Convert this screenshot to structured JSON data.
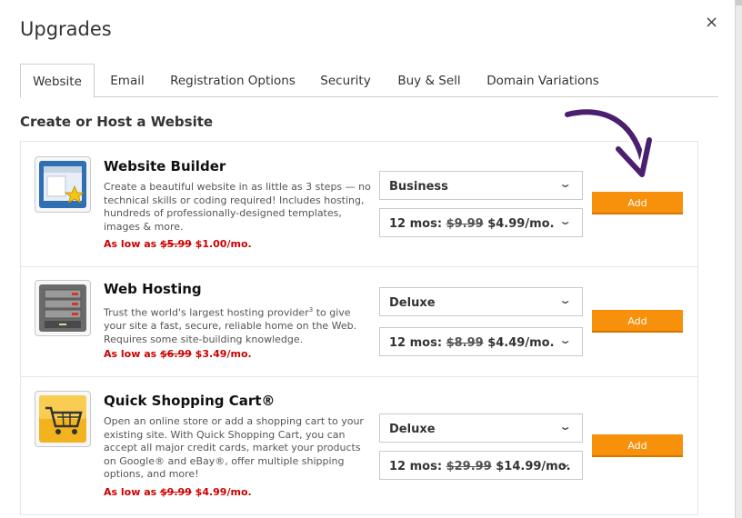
{
  "dialog": {
    "title": "Upgrades",
    "close_symbol": "×"
  },
  "tabs": [
    {
      "label": "Website",
      "active": true
    },
    {
      "label": "Email",
      "active": false
    },
    {
      "label": "Registration Options",
      "active": false
    },
    {
      "label": "Security",
      "active": false
    },
    {
      "label": "Buy & Sell",
      "active": false
    },
    {
      "label": "Domain Variations",
      "active": false
    }
  ],
  "section_title": "Create or Host a Website",
  "products": [
    {
      "name": "Website Builder",
      "icon": "website-builder-icon",
      "description": "Create a beautiful website in as little as 3 steps — no technical skills or coding required! Includes hosting, hundreds of professionally-designed templates, images & more.",
      "price_prefix": "As low as",
      "price_old": "$5.99",
      "price_new": "$1.00/mo.",
      "plan_select": "Business",
      "term_prefix": "12 mos:",
      "term_old": "$9.99",
      "term_new": "$4.99/mo.",
      "add_label": "Add"
    },
    {
      "name": "Web Hosting",
      "icon": "server-icon",
      "description_a": "Trust the world's largest hosting provider",
      "description_sup": "3",
      "description_b": " to give your site a fast, secure, reliable home on the Web. Requires some site-building knowledge.",
      "price_prefix": "As low as",
      "price_old": "$6.99",
      "price_new": "$3.49/mo.",
      "plan_select": "Deluxe",
      "term_prefix": "12 mos:",
      "term_old": "$8.99",
      "term_new": "$4.49/mo.",
      "add_label": "Add"
    },
    {
      "name": "Quick Shopping Cart®",
      "icon": "shopping-cart-icon",
      "description": "Open an online store or add a shopping cart to your existing site. With Quick Shopping Cart, you can accept all major credit cards, market your products on Google® and eBay®, offer multiple shipping options, and more!",
      "price_prefix": "As low as",
      "price_old": "$9.99",
      "price_new": "$4.99/mo.",
      "plan_select": "Deluxe",
      "term_prefix": "12 mos:",
      "term_old": "$29.99",
      "term_new": "$14.99/mo.",
      "add_label": "Add"
    }
  ],
  "colors": {
    "accent": "#f7900a",
    "price_red": "#cc0000",
    "arrow_purple": "#4b1f6f"
  }
}
